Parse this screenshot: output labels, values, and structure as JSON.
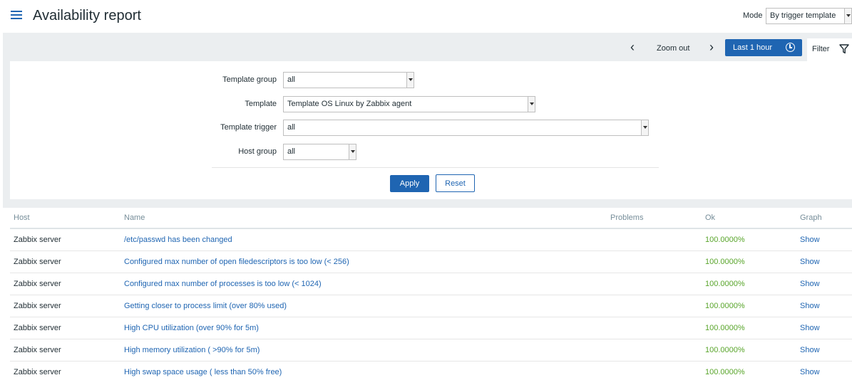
{
  "header": {
    "title": "Availability report",
    "mode_label": "Mode",
    "mode_value": "By trigger template"
  },
  "toolbar": {
    "prev_glyph": "‹",
    "zoom_out": "Zoom out",
    "next_glyph": "›",
    "time_range": "Last 1 hour",
    "filter_tab": "Filter"
  },
  "filter": {
    "template_group": {
      "label": "Template group",
      "value": "all"
    },
    "template": {
      "label": "Template",
      "value": "Template OS Linux by Zabbix agent"
    },
    "template_trigger": {
      "label": "Template trigger",
      "value": "all"
    },
    "host_group": {
      "label": "Host group",
      "value": "all"
    },
    "apply_label": "Apply",
    "reset_label": "Reset"
  },
  "table": {
    "columns": {
      "host": "Host",
      "name": "Name",
      "problems": "Problems",
      "ok": "Ok",
      "graph": "Graph"
    },
    "rows": [
      {
        "host": "Zabbix server",
        "name": "/etc/passwd has been changed",
        "problems": "",
        "ok": "100.0000%",
        "graph": "Show"
      },
      {
        "host": "Zabbix server",
        "name": "Configured max number of open filedescriptors is too low (< 256)",
        "problems": "",
        "ok": "100.0000%",
        "graph": "Show"
      },
      {
        "host": "Zabbix server",
        "name": "Configured max number of processes is too low (< 1024)",
        "problems": "",
        "ok": "100.0000%",
        "graph": "Show"
      },
      {
        "host": "Zabbix server",
        "name": "Getting closer to process limit (over 80% used)",
        "problems": "",
        "ok": "100.0000%",
        "graph": "Show"
      },
      {
        "host": "Zabbix server",
        "name": "High CPU utilization (over 90% for 5m)",
        "problems": "",
        "ok": "100.0000%",
        "graph": "Show"
      },
      {
        "host": "Zabbix server",
        "name": "High memory utilization ( >90% for 5m)",
        "problems": "",
        "ok": "100.0000%",
        "graph": "Show"
      },
      {
        "host": "Zabbix server",
        "name": "High swap space usage ( less than 50% free)",
        "problems": "",
        "ok": "100.0000%",
        "graph": "Show"
      }
    ]
  },
  "colors": {
    "accent": "#1f65b2",
    "ok_green": "#59a52b",
    "band_gray": "#ebeef0"
  },
  "icons": [
    "menu-icon",
    "clock-icon",
    "filter-icon",
    "chevron-left-icon",
    "chevron-right-icon"
  ]
}
